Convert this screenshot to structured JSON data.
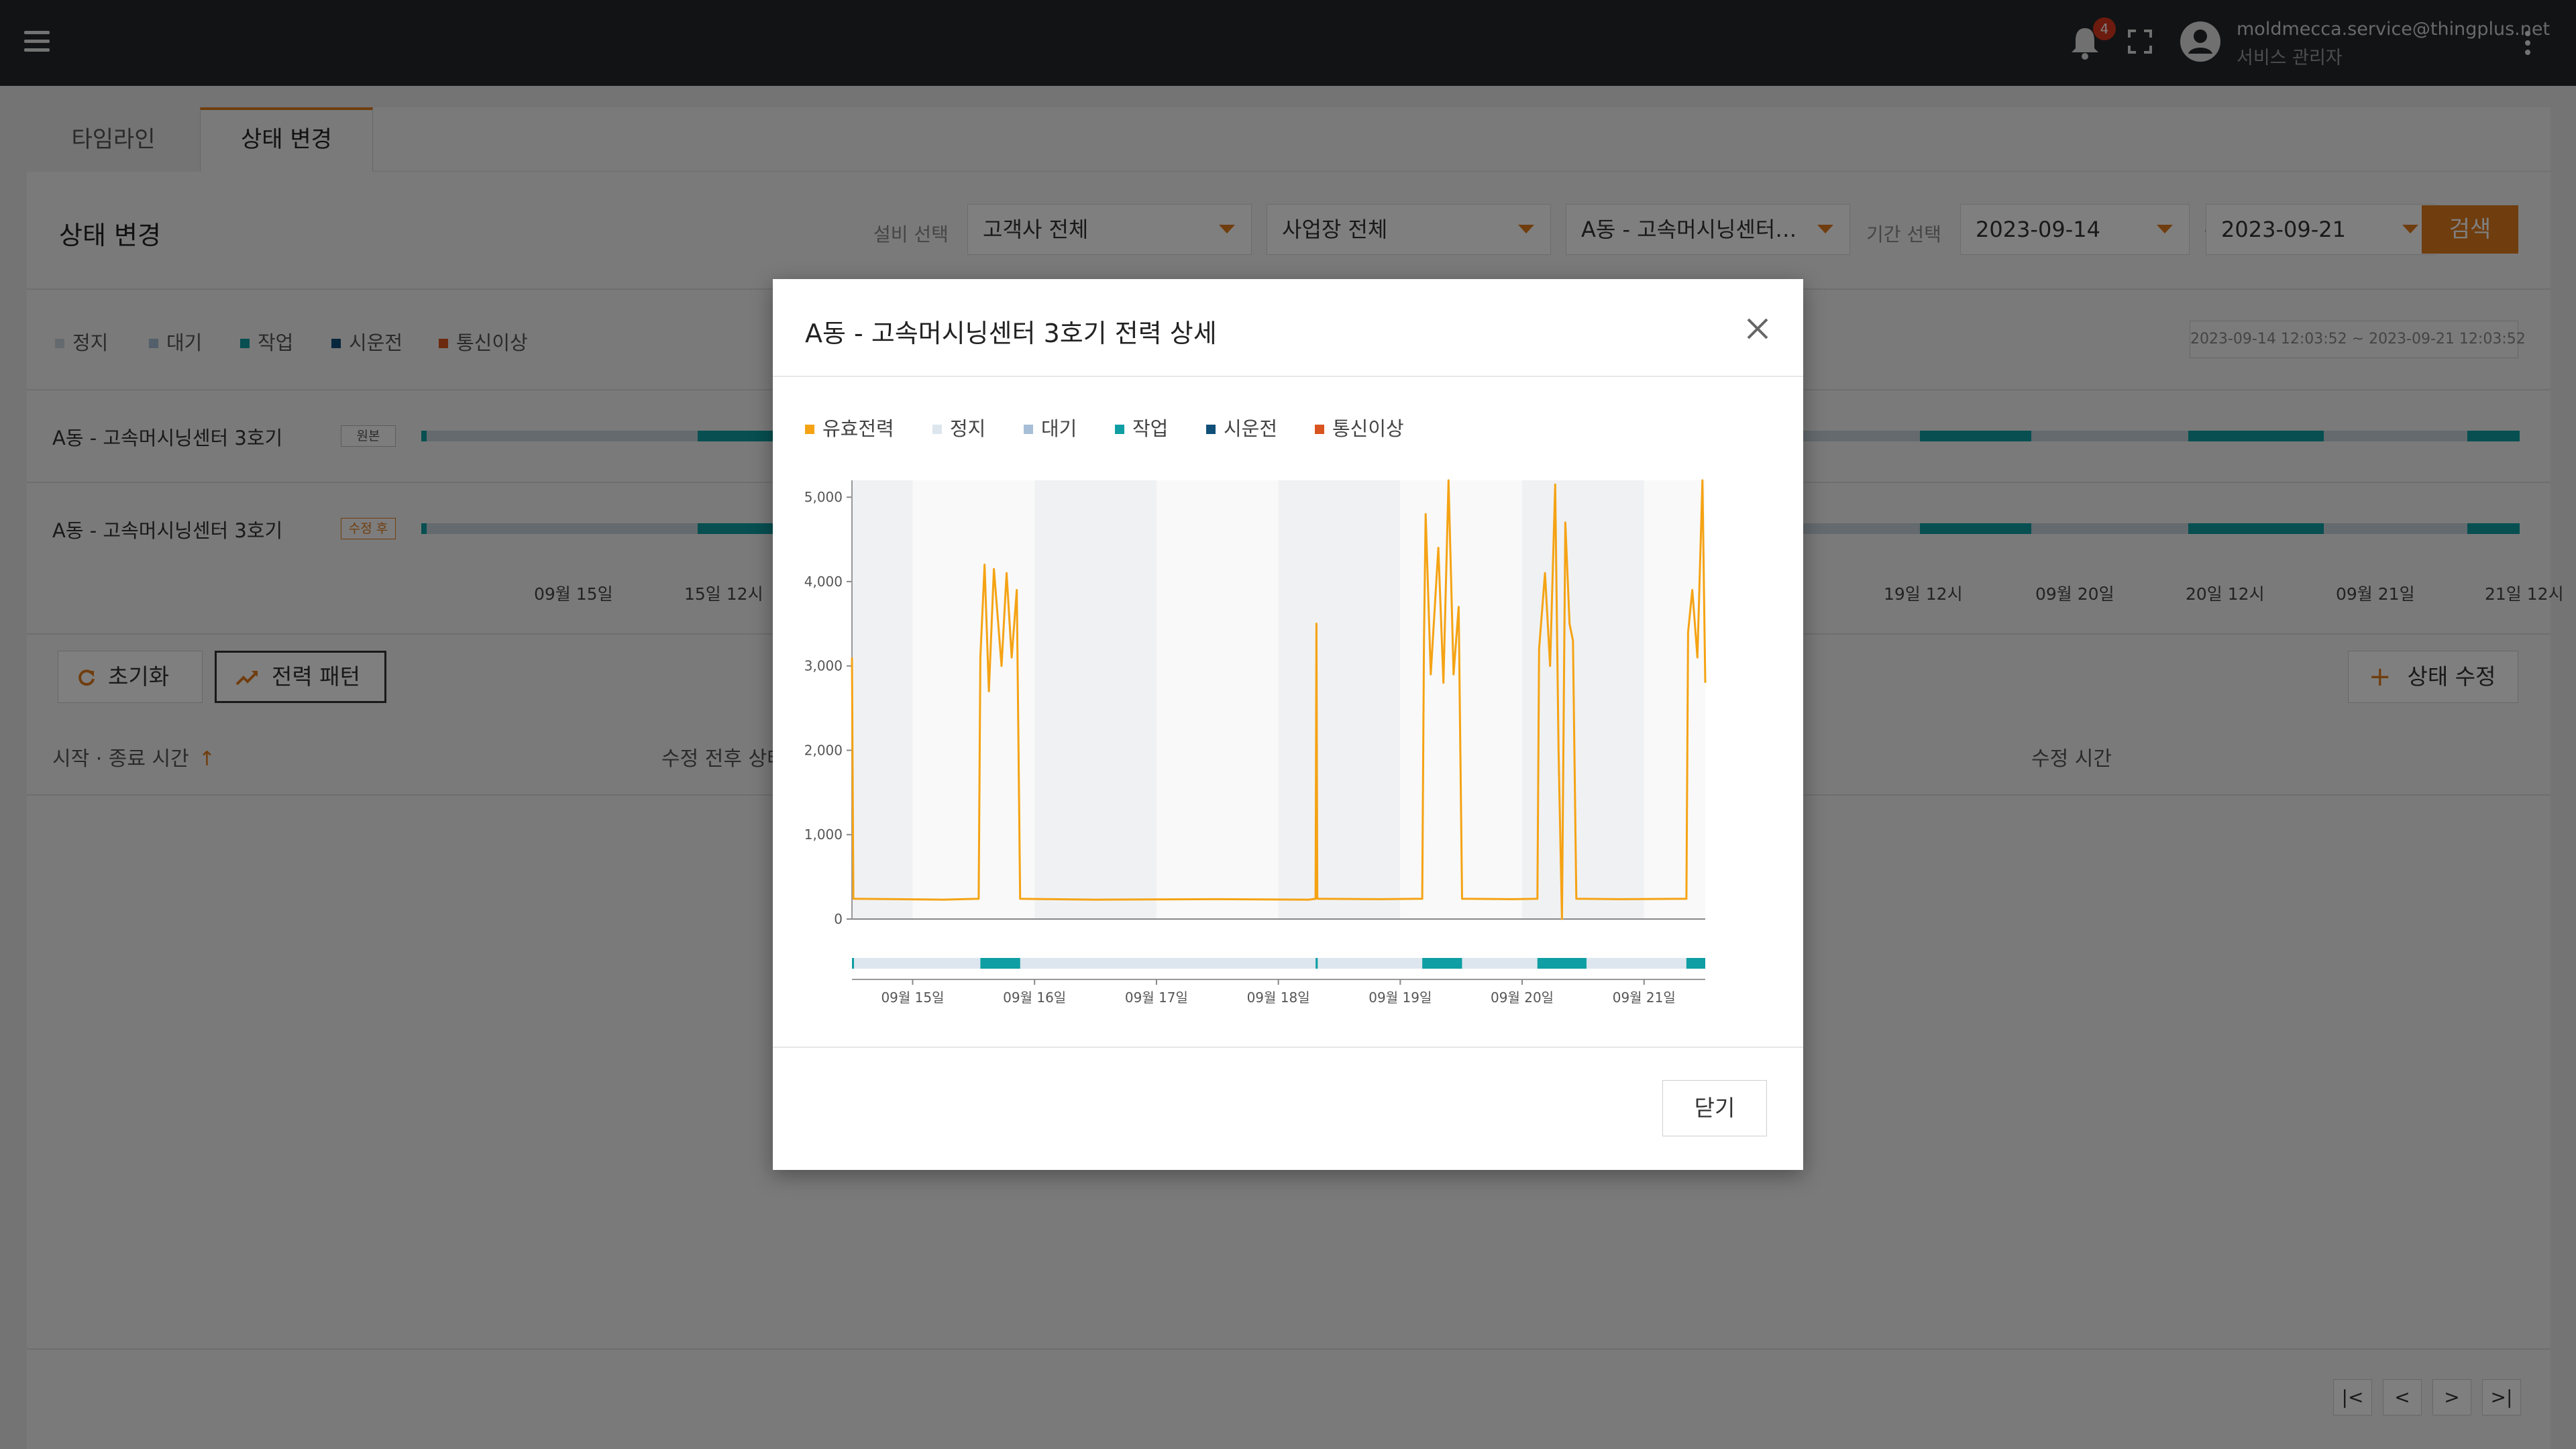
{
  "topbar": {
    "notification_count": "4",
    "email": "moldmecca.service@thingplus.net",
    "role": "서비스 관리자"
  },
  "tabs": [
    {
      "label": "타임라인",
      "active": false
    },
    {
      "label": "상태 변경",
      "active": true
    }
  ],
  "page": {
    "title": "상태 변경"
  },
  "filters": {
    "equipment_label": "설비 선택",
    "customer": "고객사 전체",
    "site": "사업장 전체",
    "equipment": "A동 - 고속머시닝센터…",
    "period_label": "기간 선택",
    "start_date": "2023-09-14",
    "tilde": "~",
    "end_date": "2023-09-21",
    "search_label": "검색"
  },
  "legend": [
    {
      "label": "정지",
      "color": "#c9d4dc"
    },
    {
      "label": "대기",
      "color": "#a7bfd6"
    },
    {
      "label": "작업",
      "color": "#0e9ea3"
    },
    {
      "label": "시운전",
      "color": "#0f4f78"
    },
    {
      "label": "통신이상",
      "color": "#d9541e"
    }
  ],
  "range_text": "2023-09-14 12:03:52 ~ 2023-09-21 12:03:52",
  "timeline": {
    "rows": [
      {
        "label": "A동 - 고속머시닝센터 3호기",
        "tag": "원본"
      },
      {
        "label": "A동 - 고속머시닝센터 3호기",
        "tag": "수정 후"
      }
    ],
    "axis_labels": [
      "09월 15일",
      "15일 12시",
      "19일 12시",
      "09월 20일",
      "20일 12시",
      "09월 21일",
      "21일 12시"
    ]
  },
  "actions": {
    "reset_label": "초기화",
    "power_pattern_label": "전력 패턴",
    "edit_status_label": "상태 수정"
  },
  "table": {
    "columns": [
      "시작 · 종료 시간",
      "수정 전후 상태",
      "수정 시간"
    ]
  },
  "pager": [
    "|<",
    "<",
    ">",
    ">|"
  ],
  "modal": {
    "title": "A동 - 고속머시닝센터 3호기 전력 상세",
    "legend": [
      {
        "label": "유효전력",
        "color": "#f5a314"
      },
      {
        "label": "정지",
        "color": "#dde6ee"
      },
      {
        "label": "대기",
        "color": "#a7bfd6"
      },
      {
        "label": "작업",
        "color": "#0e9ea3"
      },
      {
        "label": "시운전",
        "color": "#0f4f78"
      },
      {
        "label": "통신이상",
        "color": "#d9541e"
      }
    ],
    "close_label": "닫기"
  },
  "chart_data": {
    "type": "line",
    "title": "",
    "xlabel": "",
    "ylabel": "",
    "ylim": [
      0,
      5200
    ],
    "yticks": [
      0,
      1000,
      2000,
      3000,
      4000,
      5000
    ],
    "ytick_labels": [
      "0",
      "1,000",
      "2,000",
      "3,000",
      "4,000",
      "5,000"
    ],
    "xlim": [
      "2023-09-14 12:03",
      "2023-09-21 12:03"
    ],
    "xticks": [
      "2023-09-15 00:00",
      "2023-09-16 00:00",
      "2023-09-17 00:00",
      "2023-09-18 00:00",
      "2023-09-19 00:00",
      "2023-09-20 00:00",
      "2023-09-21 00:00"
    ],
    "xtick_labels": [
      "09월 15일",
      "09월 16일",
      "09월 17일",
      "09월 18일",
      "09월 19일",
      "09월 20일",
      "09월 21일"
    ],
    "series": [
      {
        "name": "유효전력",
        "color": "#f5a314",
        "points": [
          [
            "2023-09-14 12:03",
            3100
          ],
          [
            "2023-09-14 12:20",
            240
          ],
          [
            "2023-09-15 06:00",
            230
          ],
          [
            "2023-09-15 13:00",
            240
          ],
          [
            "2023-09-15 13:20",
            3100
          ],
          [
            "2023-09-15 14:10",
            4200
          ],
          [
            "2023-09-15 15:00",
            2700
          ],
          [
            "2023-09-15 16:00",
            4150
          ],
          [
            "2023-09-15 17:30",
            3000
          ],
          [
            "2023-09-15 18:30",
            4100
          ],
          [
            "2023-09-15 19:30",
            3100
          ],
          [
            "2023-09-15 20:30",
            3900
          ],
          [
            "2023-09-15 21:10",
            240
          ],
          [
            "2023-09-16 12:00",
            230
          ],
          [
            "2023-09-17 12:00",
            235
          ],
          [
            "2023-09-18 06:00",
            230
          ],
          [
            "2023-09-18 07:20",
            240
          ],
          [
            "2023-09-18 07:30",
            3500
          ],
          [
            "2023-09-18 07:40",
            240
          ],
          [
            "2023-09-18 20:00",
            235
          ],
          [
            "2023-09-19 04:20",
            240
          ],
          [
            "2023-09-19 04:40",
            3300
          ],
          [
            "2023-09-19 05:00",
            4800
          ],
          [
            "2023-09-19 06:00",
            2900
          ],
          [
            "2023-09-19 07:30",
            4400
          ],
          [
            "2023-09-19 08:30",
            2800
          ],
          [
            "2023-09-19 09:30",
            5300
          ],
          [
            "2023-09-19 10:30",
            2900
          ],
          [
            "2023-09-19 11:30",
            3700
          ],
          [
            "2023-09-19 12:10",
            240
          ],
          [
            "2023-09-19 22:00",
            235
          ],
          [
            "2023-09-20 03:00",
            240
          ],
          [
            "2023-09-20 03:20",
            3200
          ],
          [
            "2023-09-20 04:30",
            4100
          ],
          [
            "2023-09-20 05:30",
            3000
          ],
          [
            "2023-09-20 06:30",
            5150
          ],
          [
            "2023-09-20 07:10",
            2000
          ],
          [
            "2023-09-20 07:50",
            0
          ],
          [
            "2023-09-20 08:30",
            4700
          ],
          [
            "2023-09-20 09:20",
            3500
          ],
          [
            "2023-09-20 10:00",
            3300
          ],
          [
            "2023-09-20 10:40",
            240
          ],
          [
            "2023-09-20 20:00",
            235
          ],
          [
            "2023-09-21 08:20",
            240
          ],
          [
            "2023-09-21 08:40",
            3400
          ],
          [
            "2023-09-21 09:30",
            3900
          ],
          [
            "2023-09-21 10:30",
            3100
          ],
          [
            "2023-09-21 11:30",
            5200
          ],
          [
            "2023-09-21 12:03",
            2800
          ]
        ]
      }
    ],
    "status_bar": [
      {
        "start": "2023-09-14 12:03",
        "end": "2023-09-14 12:20",
        "state": "작업"
      },
      {
        "start": "2023-09-15 13:20",
        "end": "2023-09-15 21:10",
        "state": "작업"
      },
      {
        "start": "2023-09-18 07:20",
        "end": "2023-09-18 07:45",
        "state": "작업"
      },
      {
        "start": "2023-09-19 04:20",
        "end": "2023-09-19 12:10",
        "state": "작업"
      },
      {
        "start": "2023-09-20 03:00",
        "end": "2023-09-20 12:40",
        "state": "작업"
      },
      {
        "start": "2023-09-21 08:20",
        "end": "2023-09-21 12:03",
        "state": "작업"
      }
    ],
    "grid": true,
    "legend_position": "top-left"
  }
}
